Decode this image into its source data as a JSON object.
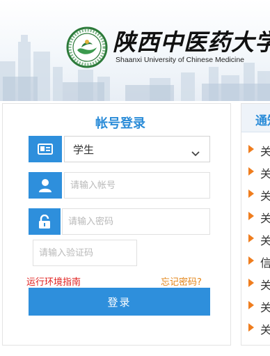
{
  "colors": {
    "accent": "#2e8fdc",
    "title_blue": "#2b8cd8",
    "guide_red": "#e0201e",
    "forgot_orange": "#e38417",
    "bullet_orange": "#ef7d1e"
  },
  "header": {
    "logo_icon": "university-seal-icon",
    "university_name_cn": "陕西中医药大学",
    "university_name_en": "Shaanxi University of Chinese Medicine"
  },
  "login": {
    "title": "帐号登录",
    "role_select": {
      "icon": "id-card-icon",
      "value": "学生"
    },
    "username": {
      "icon": "user-icon",
      "placeholder": "请输入帐号"
    },
    "password": {
      "icon": "lock-icon",
      "placeholder": "请输入密码"
    },
    "captcha": {
      "placeholder": "请输入验证码"
    },
    "guide_link": "运行环境指南",
    "forgot_link": "忘记密码?",
    "submit_label": "登录"
  },
  "notices": {
    "title": "通知",
    "items": [
      "关",
      "关",
      "关",
      "关",
      "关",
      "信",
      "关",
      "关",
      "关"
    ]
  }
}
